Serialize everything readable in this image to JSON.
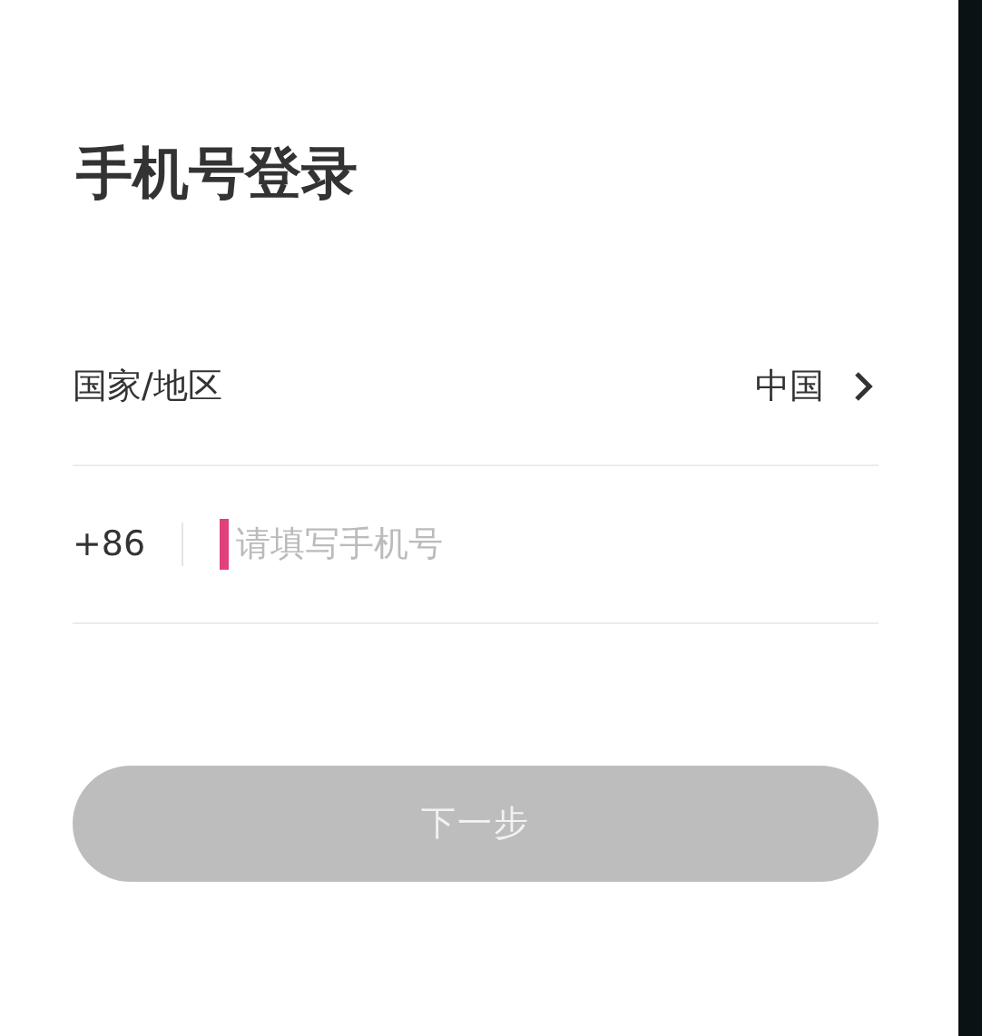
{
  "title": "手机号登录",
  "region": {
    "label": "国家/地区",
    "value": "中国"
  },
  "phone": {
    "code": "+86",
    "placeholder": "请填写手机号",
    "focused": true
  },
  "next_button": {
    "label": "下一步",
    "disabled": true
  }
}
